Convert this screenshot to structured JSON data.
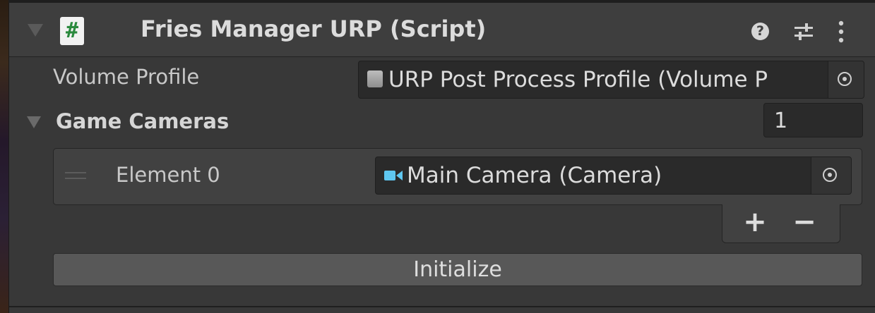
{
  "component": {
    "script_icon_glyph": "#",
    "title": "Fries Manager URP (Script)",
    "help_glyph": "?",
    "icons": {
      "foldout": "triangle-down-icon",
      "script": "csharp-script-icon",
      "help": "help-icon",
      "presets": "presets-sliders-icon",
      "more": "kebab-menu-icon"
    }
  },
  "fields": {
    "volume_profile": {
      "label": "Volume Profile",
      "value": "URP Post Process Profile (Volume P",
      "icon": "volume-profile-icon"
    },
    "game_cameras": {
      "label": "Game Cameras",
      "size": "1",
      "elements": [
        {
          "label": "Element 0",
          "value": "Main Camera (Camera)",
          "icon": "camera-icon"
        }
      ],
      "add_glyph": "+",
      "remove_glyph": "−"
    }
  },
  "actions": {
    "initialize_label": "Initialize"
  },
  "colors": {
    "panel_bg": "#383838",
    "header_bg": "#3e3e3e",
    "field_bg": "#2a2a2a",
    "button_bg": "#585858",
    "camera_icon": "#5fc7f0",
    "script_hash": "#2b8a3e"
  }
}
